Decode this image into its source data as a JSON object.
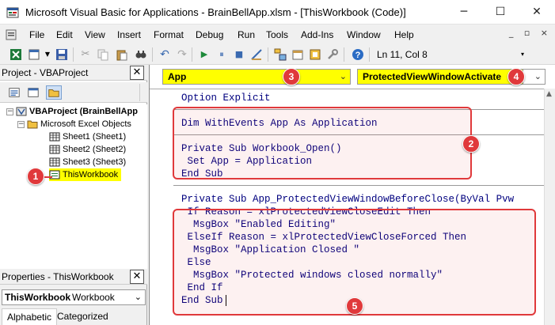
{
  "window": {
    "title": "Microsoft Visual Basic for Applications - BrainBellApp.xlsm - [ThisWorkbook (Code)]",
    "minimize_glyph": "─",
    "maximize_glyph": "☐",
    "close_glyph": "✕"
  },
  "menu": {
    "items": [
      "File",
      "Edit",
      "View",
      "Insert",
      "Format",
      "Debug",
      "Run",
      "Tools",
      "Add-Ins",
      "Window",
      "Help"
    ],
    "mdi_controls": "_ ▫ ×"
  },
  "toolbar": {
    "position": "Ln 11, Col 8"
  },
  "project_pane": {
    "title": "Project - VBAProject",
    "close_glyph": "✕",
    "tree": {
      "root": "VBAProject (BrainBellApp",
      "folder": "Microsoft Excel Objects",
      "items": [
        "Sheet1 (Sheet1)",
        "Sheet2 (Sheet2)",
        "Sheet3 (Sheet3)",
        "ThisWorkbook"
      ]
    }
  },
  "properties_pane": {
    "title": "Properties - ThisWorkbook",
    "close_glyph": "✕",
    "object_name": "ThisWorkbook",
    "object_type": "Workbook",
    "tabs": [
      "Alphabetic",
      "Categorized"
    ]
  },
  "code_window": {
    "object_combo": "App",
    "procedure_combo": "ProtectedViewWindowActivate",
    "lines": [
      "Option Explicit",
      "Dim WithEvents App As Application",
      "Private Sub Workbook_Open()",
      " Set App = Application",
      "End Sub",
      "Private Sub App_ProtectedViewWindowBeforeClose(ByVal Pvw",
      " If Reason = xlProtectedViewCloseEdit Then",
      "  MsgBox \"Enabled Editing\"",
      " ElseIf Reason = xlProtectedViewCloseForced Then",
      "  MsgBox \"Application Closed \"",
      " Else",
      "  MsgBox \"Protected windows closed normally\"",
      " End If",
      "End Sub"
    ]
  },
  "annotations": {
    "badges": [
      "1",
      "2",
      "3",
      "4",
      "5"
    ],
    "color": "#e0393b",
    "highlight_color": "#ffff00"
  }
}
